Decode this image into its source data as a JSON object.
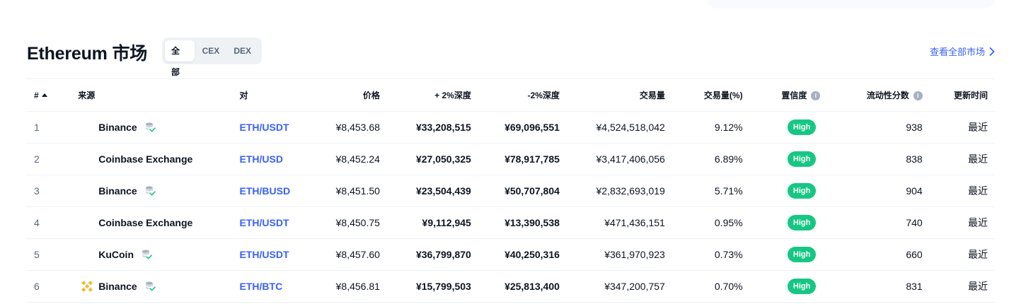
{
  "header": {
    "title": "Ethereum 市场",
    "tabs": [
      "全部",
      "CEX",
      "DEX"
    ],
    "active_tab": 0,
    "view_all": "查看全部市场"
  },
  "columns": {
    "rank": "#",
    "source": "来源",
    "pair": "对",
    "price": "价格",
    "depth_plus": "+ 2%深度",
    "depth_minus": "-2%深度",
    "volume": "交易量",
    "volume_pct": "交易量(%)",
    "confidence": "置信度",
    "liquidity": "流动性分数",
    "updated": "更新时间"
  },
  "rows": [
    {
      "rank": "1",
      "source": "Binance",
      "verified": true,
      "logo": "none",
      "pair": "ETH/USDT",
      "price": "¥8,453.68",
      "depth_plus": "¥33,208,515",
      "depth_minus": "¥69,096,551",
      "volume": "¥4,524,518,042",
      "volume_pct": "9.12%",
      "confidence": "High",
      "liquidity": "938",
      "updated": "最近"
    },
    {
      "rank": "2",
      "source": "Coinbase Exchange",
      "verified": false,
      "logo": "none",
      "pair": "ETH/USD",
      "price": "¥8,452.24",
      "depth_plus": "¥27,050,325",
      "depth_minus": "¥78,917,785",
      "volume": "¥3,417,406,056",
      "volume_pct": "6.89%",
      "confidence": "High",
      "liquidity": "838",
      "updated": "最近"
    },
    {
      "rank": "3",
      "source": "Binance",
      "verified": true,
      "logo": "none",
      "pair": "ETH/BUSD",
      "price": "¥8,451.50",
      "depth_plus": "¥23,504,439",
      "depth_minus": "¥50,707,804",
      "volume": "¥2,832,693,019",
      "volume_pct": "5.71%",
      "confidence": "High",
      "liquidity": "904",
      "updated": "最近"
    },
    {
      "rank": "4",
      "source": "Coinbase Exchange",
      "verified": false,
      "logo": "none",
      "pair": "ETH/USDT",
      "price": "¥8,450.75",
      "depth_plus": "¥9,112,945",
      "depth_minus": "¥13,390,538",
      "volume": "¥471,436,151",
      "volume_pct": "0.95%",
      "confidence": "High",
      "liquidity": "740",
      "updated": "最近"
    },
    {
      "rank": "5",
      "source": "KuCoin",
      "verified": true,
      "logo": "none",
      "pair": "ETH/USDT",
      "price": "¥8,457.60",
      "depth_plus": "¥36,799,870",
      "depth_minus": "¥40,250,316",
      "volume": "¥361,970,923",
      "volume_pct": "0.73%",
      "confidence": "High",
      "liquidity": "660",
      "updated": "最近"
    },
    {
      "rank": "6",
      "source": "Binance",
      "verified": true,
      "logo": "binance-logo-icon",
      "pair": "ETH/BTC",
      "price": "¥8,456.81",
      "depth_plus": "¥15,799,503",
      "depth_minus": "¥25,813,400",
      "volume": "¥347,200,757",
      "volume_pct": "0.70%",
      "confidence": "High",
      "liquidity": "831",
      "updated": "最近"
    }
  ],
  "colors": {
    "accent": "#3861fb",
    "high_badge": "#16c784",
    "text": "#0d1421",
    "muted": "#58667e",
    "binance": "#f3ba2f"
  }
}
